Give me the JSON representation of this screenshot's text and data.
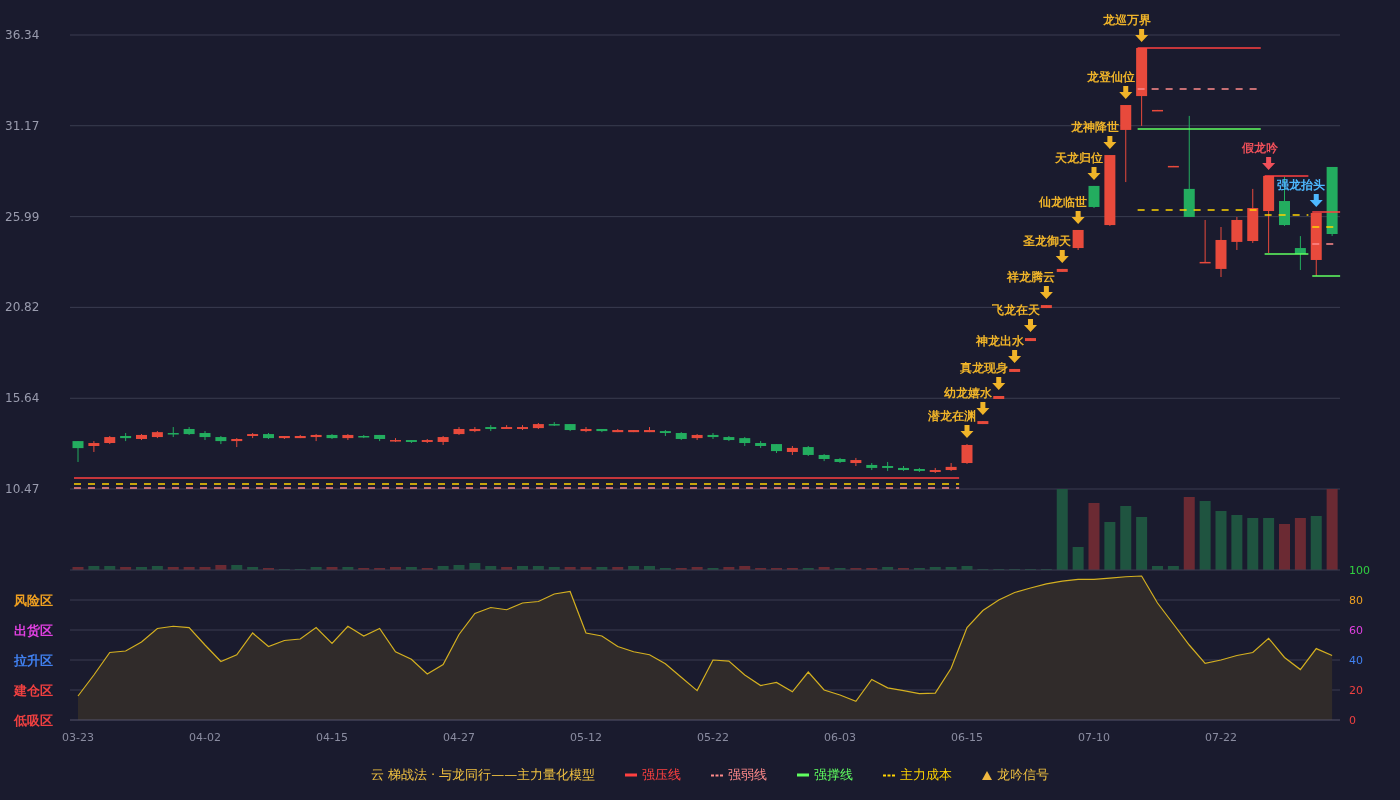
{
  "price_chart": {
    "levels": [
      {
        "name": "强压线",
        "color": "#ff4040",
        "kind": "solid"
      },
      {
        "name": "强弱线",
        "color": "#ff8a8a",
        "kind": "dashed"
      },
      {
        "name": "强撑线",
        "color": "#60ff60",
        "kind": "solid"
      },
      {
        "name": "主力成本",
        "color": "#ffd400",
        "kind": "dashed"
      }
    ],
    "signal_colors": [
      {
        "color": "#f0b429"
      },
      {
        "color": "#f0b429"
      },
      {
        "color": "#f0b429"
      },
      {
        "color": "#f0b429"
      },
      {
        "color": "#f0b429"
      },
      {
        "color": "#f0b429"
      },
      {
        "color": "#f0b429"
      },
      {
        "color": "#f0b429"
      },
      {
        "color": "#f0b429"
      },
      {
        "color": "#f0b429"
      },
      {
        "color": "#f0b429"
      },
      {
        "color": "#f0b429"
      },
      {
        "color": "#f0505a"
      },
      {
        "color": "#4db8ff"
      }
    ],
    "chart_data": {
      "type": "candlestick",
      "grid": true,
      "ylim": [
        10.47,
        36.34
      ],
      "yticks": [
        36.34,
        31.17,
        25.99,
        20.82,
        15.64,
        10.47
      ],
      "categories": [
        null,
        null,
        null,
        null,
        null,
        null,
        null,
        null,
        null,
        null,
        null,
        null,
        null,
        null,
        null,
        null,
        null,
        null,
        null,
        null,
        null,
        null,
        null,
        null,
        null,
        null,
        null,
        null,
        null,
        null,
        null,
        null,
        null,
        null,
        null,
        null,
        null,
        null,
        null,
        null,
        null,
        null,
        null,
        null,
        null,
        null,
        null,
        null,
        null,
        null,
        null,
        null,
        null,
        null,
        null,
        null,
        null,
        null,
        null,
        null,
        null,
        null,
        null,
        null,
        null,
        null,
        null,
        null,
        null,
        null,
        null,
        null,
        null,
        null,
        null,
        null,
        null,
        null,
        null,
        null
      ],
      "ohlc": [
        [
          13.2,
          13.2,
          12.01,
          12.8
        ],
        [
          12.92,
          13.2,
          12.58,
          13.09
        ],
        [
          13.09,
          13.49,
          13.03,
          13.43
        ],
        [
          13.49,
          13.66,
          13.2,
          13.37
        ],
        [
          13.32,
          13.6,
          13.26,
          13.55
        ],
        [
          13.43,
          13.77,
          13.37,
          13.71
        ],
        [
          13.66,
          14.0,
          13.43,
          13.6
        ],
        [
          13.89,
          14.0,
          13.55,
          13.6
        ],
        [
          13.66,
          13.77,
          13.26,
          13.43
        ],
        [
          13.43,
          13.49,
          13.03,
          13.2
        ],
        [
          13.2,
          13.37,
          12.86,
          13.32
        ],
        [
          13.49,
          13.66,
          13.37,
          13.6
        ],
        [
          13.6,
          13.66,
          13.32,
          13.37
        ],
        [
          13.37,
          13.49,
          13.32,
          13.49
        ],
        [
          13.37,
          13.55,
          13.37,
          13.49
        ],
        [
          13.43,
          13.6,
          13.2,
          13.55
        ],
        [
          13.55,
          13.6,
          13.32,
          13.37
        ],
        [
          13.37,
          13.6,
          13.26,
          13.55
        ],
        [
          13.49,
          13.55,
          13.37,
          13.43
        ],
        [
          13.55,
          13.55,
          13.2,
          13.32
        ],
        [
          13.2,
          13.37,
          13.15,
          13.26
        ],
        [
          13.26,
          13.26,
          13.09,
          13.15
        ],
        [
          13.15,
          13.32,
          13.09,
          13.26
        ],
        [
          13.15,
          13.49,
          12.98,
          13.43
        ],
        [
          13.6,
          14.0,
          13.55,
          13.89
        ],
        [
          13.77,
          14.0,
          13.71,
          13.89
        ],
        [
          14.0,
          14.11,
          13.77,
          13.89
        ],
        [
          13.89,
          14.11,
          13.89,
          14.0
        ],
        [
          13.89,
          14.11,
          13.83,
          14.0
        ],
        [
          13.94,
          14.23,
          13.89,
          14.17
        ],
        [
          14.17,
          14.28,
          14.06,
          14.11
        ],
        [
          14.17,
          14.17,
          13.77,
          13.83
        ],
        [
          13.77,
          14.0,
          13.71,
          13.89
        ],
        [
          13.89,
          13.89,
          13.71,
          13.77
        ],
        [
          13.71,
          13.89,
          13.71,
          13.83
        ],
        [
          13.71,
          13.83,
          13.71,
          13.83
        ],
        [
          13.71,
          14.0,
          13.71,
          13.83
        ],
        [
          13.77,
          13.83,
          13.49,
          13.66
        ],
        [
          13.66,
          13.71,
          13.26,
          13.32
        ],
        [
          13.37,
          13.6,
          13.26,
          13.55
        ],
        [
          13.55,
          13.66,
          13.32,
          13.43
        ],
        [
          13.43,
          13.49,
          13.2,
          13.26
        ],
        [
          13.37,
          13.43,
          12.92,
          13.09
        ],
        [
          13.09,
          13.2,
          12.81,
          12.92
        ],
        [
          13.03,
          13.03,
          12.52,
          12.63
        ],
        [
          12.58,
          12.92,
          12.41,
          12.81
        ],
        [
          12.86,
          12.92,
          12.35,
          12.41
        ],
        [
          12.41,
          12.46,
          12.06,
          12.18
        ],
        [
          12.18,
          12.24,
          11.95,
          12.01
        ],
        [
          11.95,
          12.24,
          11.78,
          12.12
        ],
        [
          11.84,
          11.95,
          11.55,
          11.67
        ],
        [
          11.78,
          12.01,
          11.5,
          11.67
        ],
        [
          11.67,
          11.78,
          11.5,
          11.55
        ],
        [
          11.61,
          11.67,
          11.44,
          11.5
        ],
        [
          11.44,
          11.67,
          11.38,
          11.55
        ],
        [
          11.55,
          11.95,
          11.5,
          11.73
        ],
        [
          11.95,
          13.03,
          11.9,
          12.98
        ],
        [
          14.17,
          14.34,
          14.17,
          14.34
        ],
        [
          15.6,
          15.77,
          15.6,
          15.77
        ],
        [
          17.14,
          17.31,
          17.14,
          17.31
        ],
        [
          18.9,
          19.07,
          18.9,
          19.07
        ],
        [
          20.78,
          20.95,
          20.78,
          20.95
        ],
        [
          22.84,
          23.01,
          22.84,
          23.01
        ],
        [
          24.2,
          25.23,
          24.09,
          25.23
        ],
        [
          27.74,
          27.74,
          26.48,
          26.54
        ],
        [
          25.51,
          29.5,
          25.46,
          29.5
        ],
        [
          30.93,
          32.35,
          27.96,
          32.35
        ],
        [
          32.86,
          35.6,
          31.16,
          35.6
        ],
        [
          32.01,
          32.07,
          32.01,
          32.07
        ],
        [
          28.82,
          28.88,
          28.82,
          28.88
        ],
        [
          27.57,
          31.73,
          25.97,
          25.97
        ],
        [
          23.35,
          25.8,
          23.35,
          23.41
        ],
        [
          23.01,
          25.4,
          22.55,
          24.66
        ],
        [
          24.55,
          25.97,
          24.09,
          25.8
        ],
        [
          24.6,
          27.57,
          24.49,
          26.48
        ],
        [
          26.31,
          28.31,
          23.92,
          28.31
        ],
        [
          26.88,
          28.25,
          25.46,
          25.51
        ],
        [
          24.2,
          24.88,
          22.95,
          23.86
        ],
        [
          23.52,
          26.2,
          22.61,
          26.2
        ],
        [
          28.82,
          28.82,
          24.89,
          25.0
        ]
      ],
      "value_labels": [
        null,
        null,
        null,
        null,
        null,
        null,
        null,
        null,
        null,
        null,
        null,
        null,
        null,
        null,
        null,
        null,
        null,
        null,
        null,
        null,
        null,
        null,
        null,
        null,
        null,
        null,
        null,
        null,
        null,
        null,
        null,
        null,
        null,
        null,
        null,
        null,
        null,
        null,
        null,
        null,
        null,
        null,
        null,
        null,
        null,
        null,
        null,
        null,
        null,
        null,
        null,
        null,
        null,
        null,
        null,
        null,
        "潜龙在渊",
        "幼龙嬉水",
        "真龙现身",
        "神龙出水",
        "飞龙在天",
        "祥龙腾云",
        "圣龙御天",
        "仙龙临世",
        "天龙归位",
        "龙神降世",
        "龙登仙位",
        "龙巡万界",
        null,
        null,
        null,
        null,
        null,
        null,
        null,
        "假龙吟",
        null,
        null,
        "强龙抬头",
        null
      ]
    }
  },
  "oscillator": {
    "zones": [
      {
        "label": "风险区",
        "color": "#f0a020"
      },
      {
        "label": "出货区",
        "color": "#e040e0"
      },
      {
        "label": "拉升区",
        "color": "#4080f0"
      },
      {
        "label": "建仓区",
        "color": "#f04040"
      },
      {
        "label": "低吸区",
        "color": "#f04040"
      }
    ],
    "tick_colors": [
      {
        "color": "#30d040"
      },
      {
        "color": "#f0a020"
      },
      {
        "color": "#e040e0"
      },
      {
        "color": "#4080f0"
      },
      {
        "color": "#f04040"
      },
      {
        "color": "#f04040"
      }
    ],
    "chart_data": {
      "type": "area",
      "grid": true,
      "ylim": [
        0,
        100
      ],
      "yticks": [
        100,
        80,
        60,
        40,
        20,
        0
      ],
      "categories": [
        "03-23",
        null,
        null,
        null,
        null,
        null,
        null,
        null,
        "04-02",
        null,
        null,
        null,
        null,
        null,
        null,
        null,
        "04-15",
        null,
        null,
        null,
        null,
        null,
        null,
        null,
        "04-27",
        null,
        null,
        null,
        null,
        null,
        null,
        null,
        "05-12",
        null,
        null,
        null,
        null,
        null,
        null,
        null,
        "05-22",
        null,
        null,
        null,
        null,
        null,
        null,
        null,
        "06-03",
        null,
        null,
        null,
        null,
        null,
        null,
        null,
        "06-15",
        null,
        null,
        null,
        null,
        null,
        null,
        null,
        "07-10",
        null,
        null,
        null,
        null,
        null,
        null,
        null,
        "07-22",
        null,
        null,
        null,
        null,
        null,
        null,
        null
      ],
      "series": [
        {
          "color": "#d4b020",
          "values": [
            16,
            30,
            45,
            46,
            52,
            61,
            62.5,
            61.6,
            50,
            39,
            43.5,
            58,
            49,
            53,
            54,
            61.6,
            51,
            62.5,
            56,
            61,
            45.5,
            40.5,
            30.7,
            37,
            57,
            71,
            75,
            73.5,
            78,
            79,
            84,
            85.7,
            58,
            56,
            49,
            45.5,
            43.5,
            37.5,
            28.5,
            19.6,
            40,
            39.3,
            30,
            23,
            25,
            18.8,
            32,
            20,
            16.7,
            12.5,
            27,
            21.4,
            19.6,
            17.6,
            17.9,
            34.5,
            61.6,
            73,
            80,
            85,
            88,
            90.8,
            92.6,
            93.8,
            93.8,
            94.6,
            95.5,
            96,
            78,
            64,
            50,
            37.8,
            40,
            43,
            45,
            54.5,
            41.7,
            33.6,
            47.6,
            43
          ]
        }
      ]
    }
  },
  "legend": {
    "title": "云 梯战法 · 与龙同行——主力量化模型",
    "signal": "龙吟信号"
  }
}
